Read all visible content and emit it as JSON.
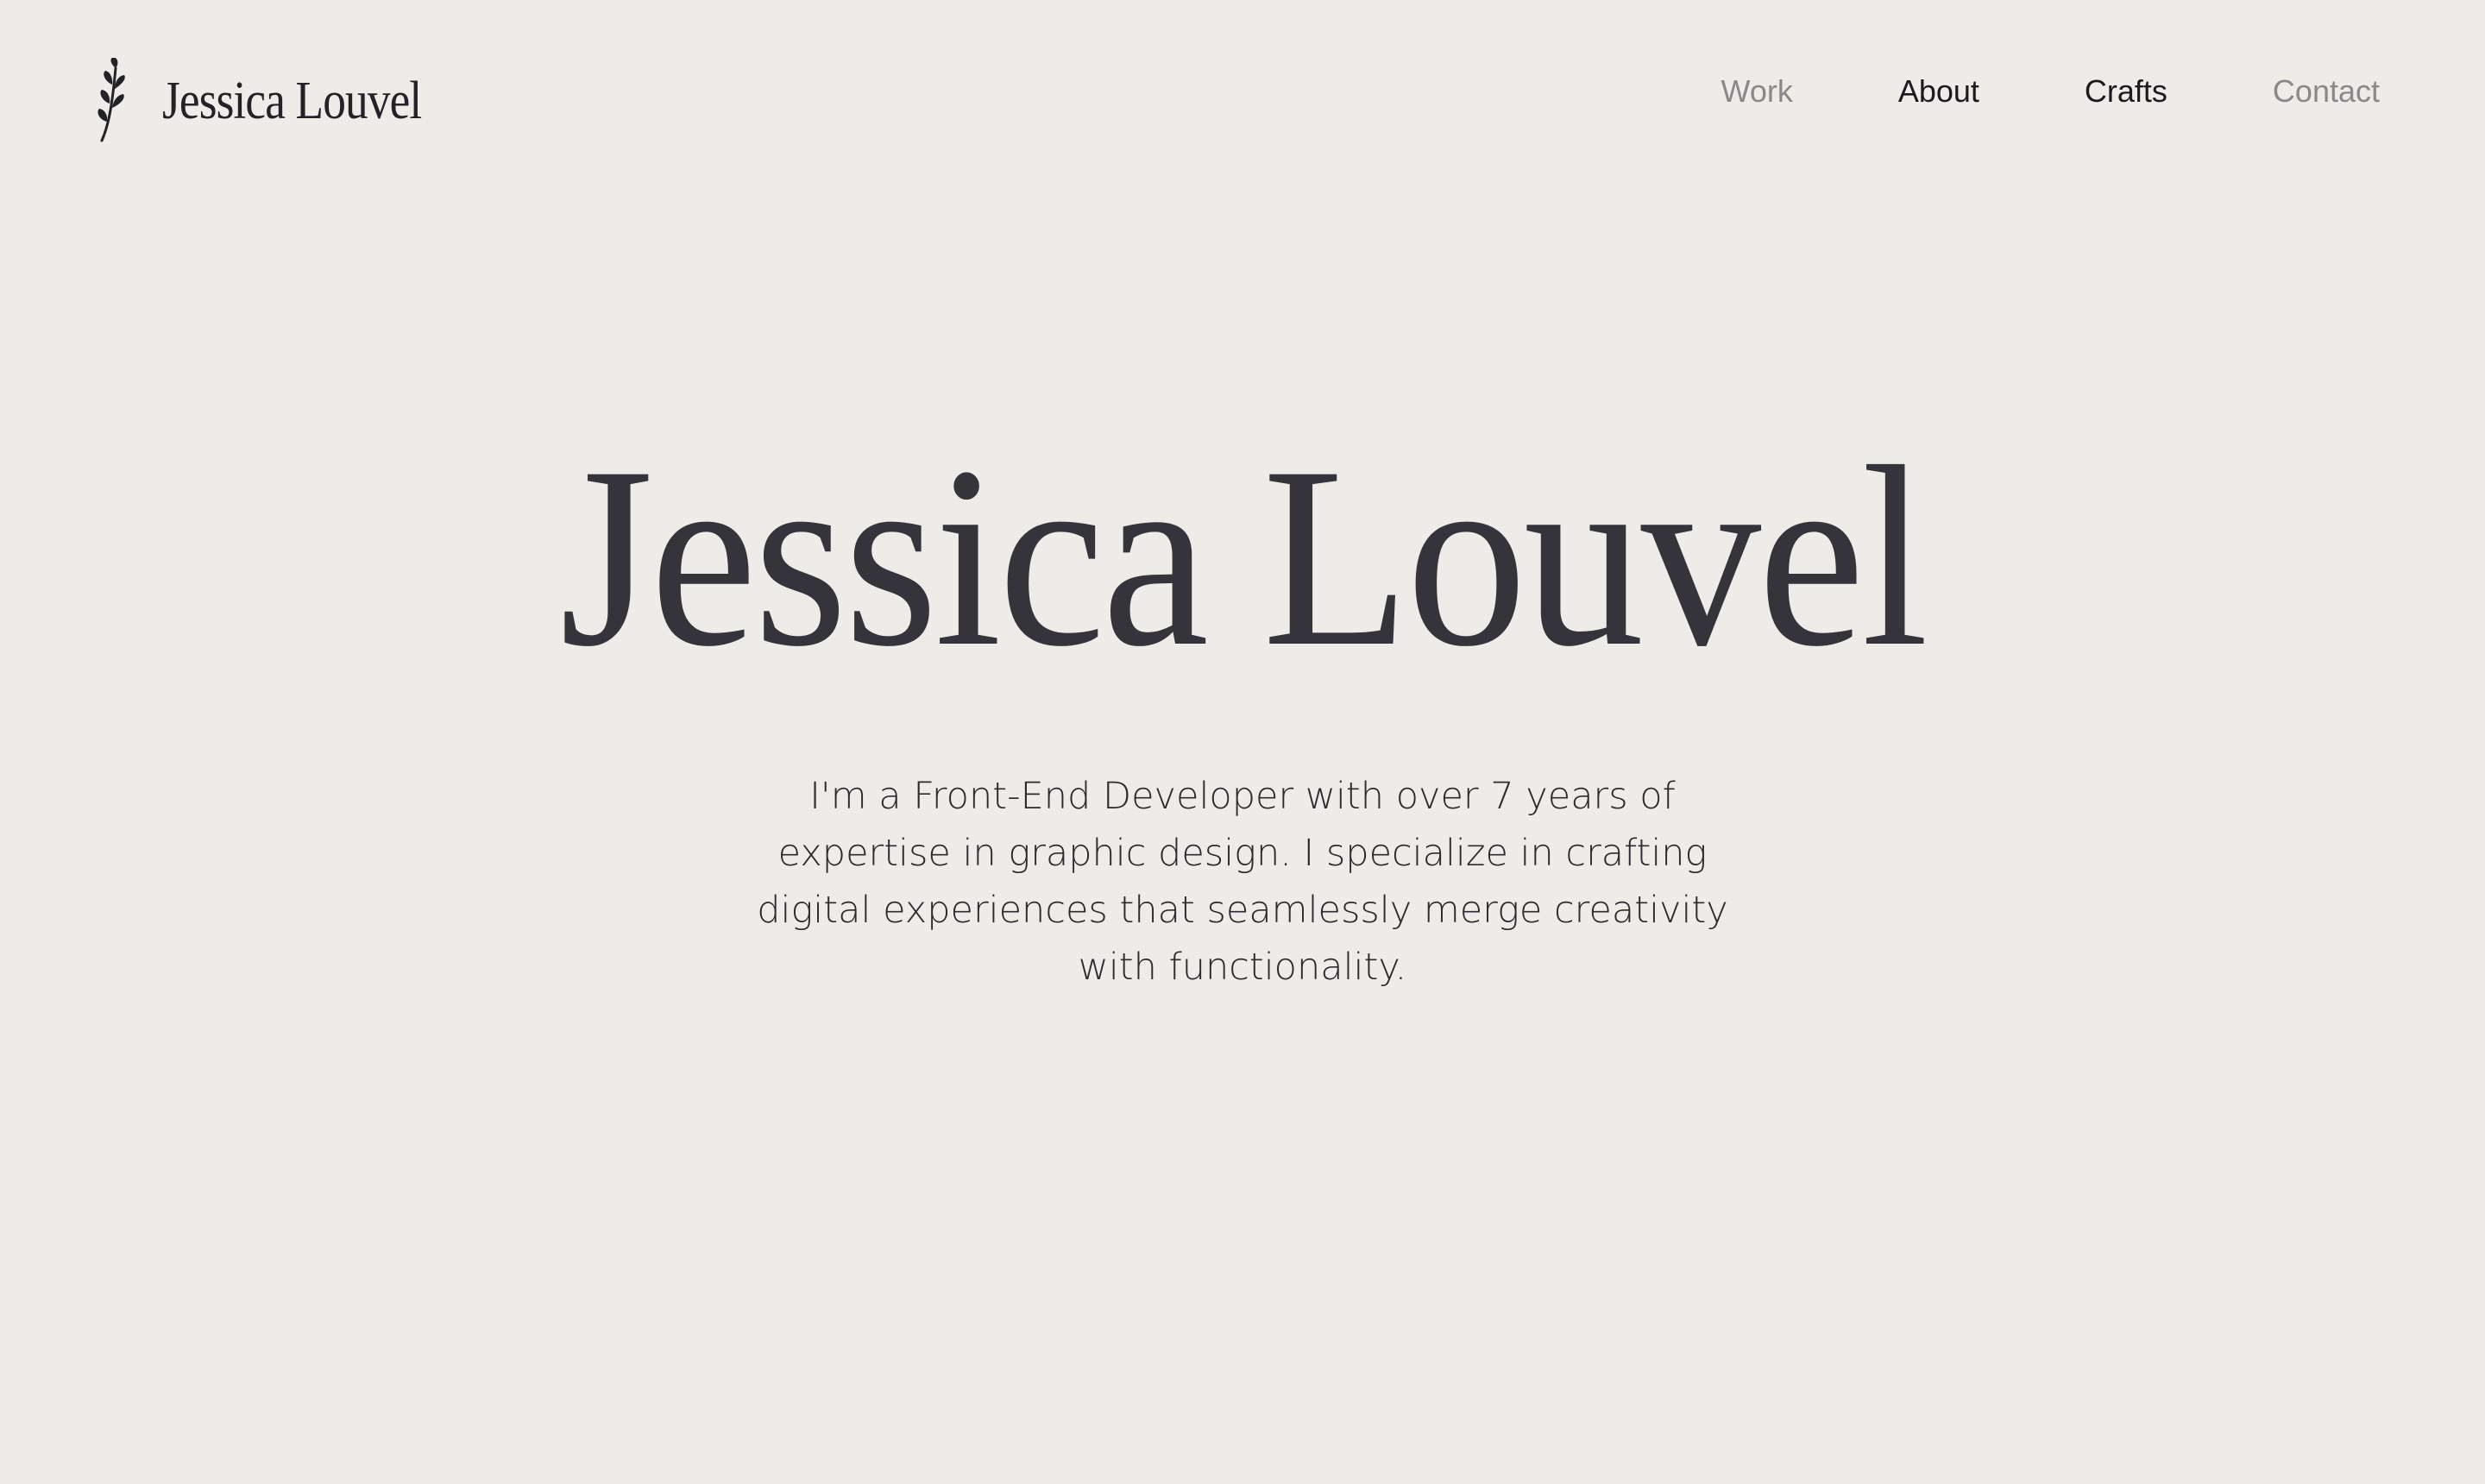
{
  "header": {
    "logo_icon": "olive-branch-icon",
    "brand_name": "Jessica Louvel",
    "nav": {
      "work": "Work",
      "about": "About",
      "crafts": "Crafts",
      "contact": "Contact"
    }
  },
  "hero": {
    "title": "Jessica Louvel",
    "description": "I'm a Front-End Developer with over 7 years of expertise in graphic design. I specialize in crafting digital experiences that seamlessly merge creativity with functionality."
  },
  "colors": {
    "background": "#eeebe8",
    "text": "#35343a",
    "nav_active": "#1b1a1f",
    "nav_muted": "#8a888a"
  }
}
